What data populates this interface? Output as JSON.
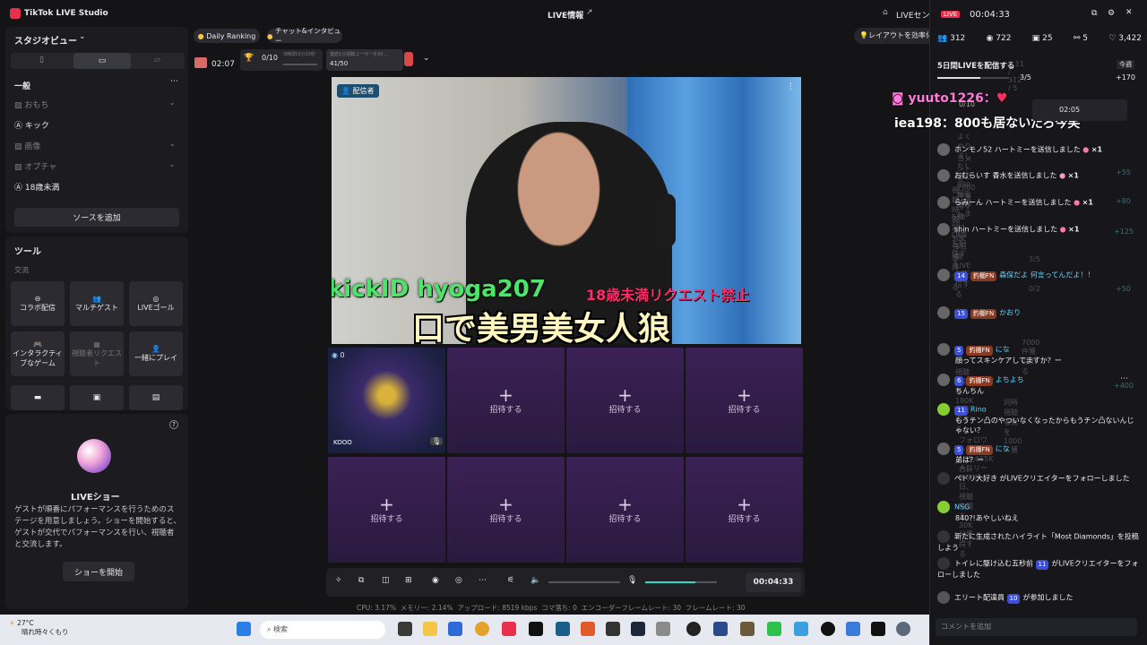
{
  "app": {
    "title": "TikTok LIVE Studio",
    "center_title": "LIVE情報",
    "right_title": "LIVEセンタ"
  },
  "left": {
    "studio_view": "スタジオビュー",
    "general": "一般",
    "scenes": [
      "おもち",
      "キック",
      "画像",
      "オプチャ",
      "18歳未満"
    ],
    "add_source": "ソースを追加",
    "tools": "ツール",
    "exchange": "交流",
    "tool_items": [
      "コラボ配信",
      "マルチゲスト",
      "LIVEゴール",
      "インタラクティブなゲーム",
      "視聴者リクエスト",
      "一緒にプレイ"
    ]
  },
  "show": {
    "title": "LIVEショー",
    "desc": "ゲストが順番にパフォーマンスを行うためのステージを用意しましょう。ショーを開始すると、ゲストが交代でパフォーマンスを行い、視聴者と交流します。",
    "button": "ショーを開始"
  },
  "top": {
    "daily_ranking": "Daily Ranking",
    "chat_interview": "チャット&インタビュー",
    "timer": "02:07",
    "goal": "0/10",
    "goal_sub": "3時間55分33秒",
    "viewer_goal": "連続1分視聴ユーザーを50...",
    "viewer_goal_val": "41/50"
  },
  "stage": {
    "host_label": "配信者",
    "overlay_kick": "kickID hyoga207",
    "overlay_minor": "18歳未満リクエスト禁止",
    "overlay_title": "口で美男美女人狼",
    "guest_name": "KOOO",
    "guest_count": "0",
    "invite": "招待する"
  },
  "controls": {
    "timer": "00:04:33"
  },
  "status": {
    "cpu": "CPU: 3.17%",
    "mem": "メモリー: 2.14%",
    "upload": "アップロード: 8519 kbps",
    "drop": "コマ落ち: 0",
    "enc": "エンコーダーフレームレート: 30",
    "fps": "フレームレート: 30"
  },
  "right": {
    "live": "LIVE",
    "timer": "00:04:33",
    "stats": [
      "312",
      "722",
      "25",
      "5",
      "3,422"
    ],
    "layout_tip": "レイアウトを効率化",
    "task": "5日間LIVEを配信する",
    "task_progress": "3/5",
    "task_reward": "+170",
    "today": "今週",
    "bottom_input": "コメントを追加",
    "overlay1": "yuuto1226：",
    "overlay2": "iea198：800も居ないだろ今笑",
    "goal_mini": "0/10",
    "goal_mini_time": "02:05",
    "chat": [
      {
        "user": "ホンモノ52",
        "text": "ハートミーを送信しました",
        "count": "×1"
      },
      {
        "user": "おむらいす",
        "text": "香水を送信しました",
        "count": "×1"
      },
      {
        "user": "らみーん",
        "text": "ハートミーを送信しました",
        "count": "×1"
      },
      {
        "user": "shin",
        "text": "ハートミーを送信しました",
        "count": "×1"
      }
    ],
    "chat2": [
      {
        "level": "14",
        "fan": "釣棚FN",
        "user": "森保だよ",
        "text": "何言ってんだよ！！"
      },
      {
        "level": "15",
        "fan": "釣棚FN",
        "user": "かおり",
        "text": ""
      },
      {
        "level": "5",
        "fan": "釣棚FN",
        "user": "にな",
        "text": "顔ってスキンケアしてますか？ー"
      },
      {
        "level": "6",
        "fan": "釣棚FN",
        "user": "よちよち",
        "text": "ちんちん"
      },
      {
        "level": "11",
        "fan": "",
        "user": "Rino",
        "text": "もうチン凸のやついなくなったからもうチン凸ないんじゃない？"
      },
      {
        "level": "5",
        "fan": "釣棚FN",
        "user": "にな",
        "text": "弟は？ー"
      }
    ],
    "follow1": "ぺドリ大好き がLIVEクリエイターをフォローしました",
    "nsg_user": "NSG",
    "nsg_text": "840?!あやしいねえ",
    "highlight": "新たに生成されたハイライト「Most Diamonds」を投稿しよう",
    "follow2": "トイレに駆け込む五秒前",
    "follow2_level": "11",
    "follow2_text": "がLIVEクリエイターをフォローしました",
    "join_user": "エリート配達員",
    "join_level": "10",
    "join_text": "が参加しました",
    "ghosts": {
      "g1": "0.11 / 312 / 5",
      "g2": "よくやりました！宝石890個を獲得しました。",
      "g3": "コメントを7000件獲得する",
      "g4": "視聴時間を30K分獲得する",
      "g5": "550分LIVEを配信する",
      "g6": "5日間LIVEを配信する",
      "g7": "3/5",
      "g8": "0/2",
      "g9": "7000件獲得する",
      "g10": "視聴時間を180K分獲得する",
      "g11": "同時視聴者数を1000人獲",
      "g12": "フォロワー105,665K人にリーチする",
      "g13": "合計2日、視聴時間を30K分獲得する"
    },
    "ghost_rewards": [
      "+55",
      "+80",
      "+125",
      "+50",
      "+400"
    ]
  },
  "taskbar": {
    "weather_temp": "27°C",
    "weather_desc": "晴れ時々くもり",
    "search": "検索"
  }
}
